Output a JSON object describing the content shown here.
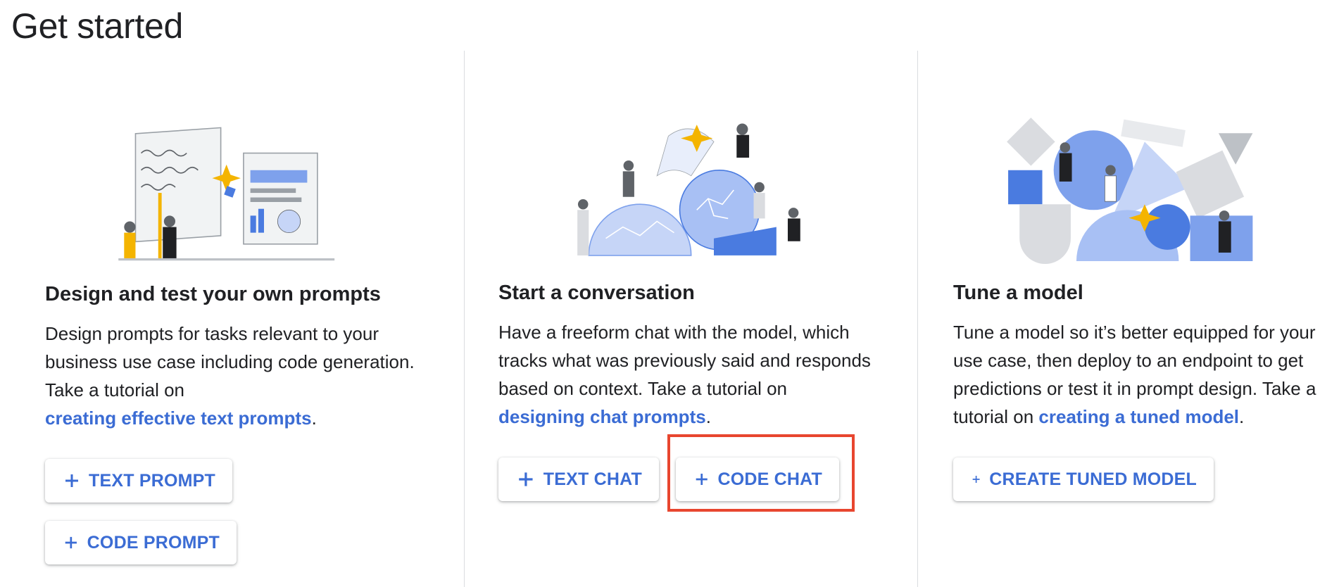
{
  "page": {
    "title": "Get started"
  },
  "cards": [
    {
      "title": "Design and test your own prompts",
      "desc_text": "Design prompts for tasks relevant to your business use case including code generation. Take a tutorial on",
      "link": "creating effective text prompts",
      "desc_end": ".",
      "illustration": "prompt-design-illustration",
      "buttons": [
        {
          "label": "TEXT PROMPT",
          "icon": "plus-icon"
        },
        {
          "label": "CODE PROMPT",
          "icon": "plus-icon"
        }
      ]
    },
    {
      "title": "Start a conversation",
      "desc_text": "Have a freeform chat with the model, which tracks what was previously said and responds based on context. Take a tutorial on",
      "link": "designing chat prompts",
      "desc_end": ".",
      "illustration": "conversation-illustration",
      "buttons": [
        {
          "label": "TEXT CHAT",
          "icon": "plus-icon"
        },
        {
          "label": "CODE CHAT",
          "icon": "plus-icon"
        }
      ]
    },
    {
      "title": "Tune a model",
      "desc_text": "Tune a model so it’s better equipped for your use case, then deploy to an endpoint to get predictions or test it in prompt design. Take a tutorial on",
      "link": "creating a tuned model",
      "desc_end": ".",
      "illustration": "tune-model-illustration",
      "buttons": [
        {
          "label": "CREATE TUNED MODEL",
          "icon": "plus-icon"
        }
      ]
    }
  ],
  "colors": {
    "accent": "#3b6cd4",
    "highlight": "#e8462f",
    "divider": "#dadce0",
    "illustration_blue": "#7ea1ec",
    "illustration_star": "#f4b400"
  }
}
